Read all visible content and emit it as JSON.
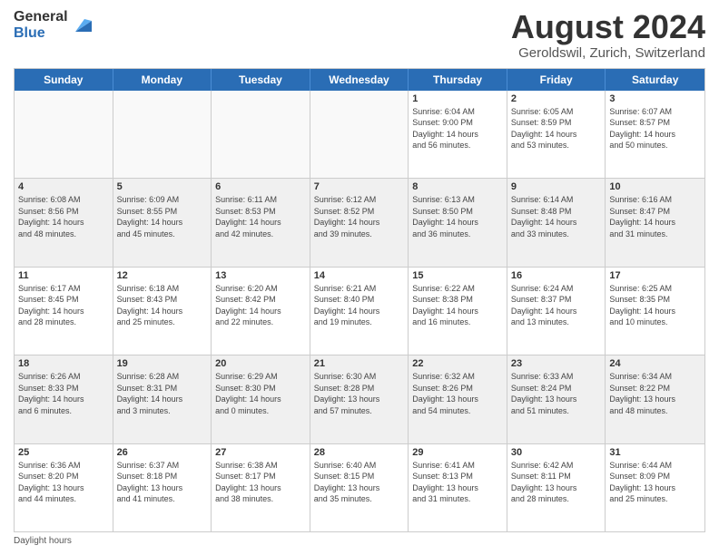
{
  "logo": {
    "general": "General",
    "blue": "Blue"
  },
  "title": "August 2024",
  "subtitle": "Geroldswil, Zurich, Switzerland",
  "header_days": [
    "Sunday",
    "Monday",
    "Tuesday",
    "Wednesday",
    "Thursday",
    "Friday",
    "Saturday"
  ],
  "footer": "Daylight hours",
  "weeks": [
    [
      {
        "day": "",
        "info": ""
      },
      {
        "day": "",
        "info": ""
      },
      {
        "day": "",
        "info": ""
      },
      {
        "day": "",
        "info": ""
      },
      {
        "day": "1",
        "info": "Sunrise: 6:04 AM\nSunset: 9:00 PM\nDaylight: 14 hours\nand 56 minutes."
      },
      {
        "day": "2",
        "info": "Sunrise: 6:05 AM\nSunset: 8:59 PM\nDaylight: 14 hours\nand 53 minutes."
      },
      {
        "day": "3",
        "info": "Sunrise: 6:07 AM\nSunset: 8:57 PM\nDaylight: 14 hours\nand 50 minutes."
      }
    ],
    [
      {
        "day": "4",
        "info": "Sunrise: 6:08 AM\nSunset: 8:56 PM\nDaylight: 14 hours\nand 48 minutes."
      },
      {
        "day": "5",
        "info": "Sunrise: 6:09 AM\nSunset: 8:55 PM\nDaylight: 14 hours\nand 45 minutes."
      },
      {
        "day": "6",
        "info": "Sunrise: 6:11 AM\nSunset: 8:53 PM\nDaylight: 14 hours\nand 42 minutes."
      },
      {
        "day": "7",
        "info": "Sunrise: 6:12 AM\nSunset: 8:52 PM\nDaylight: 14 hours\nand 39 minutes."
      },
      {
        "day": "8",
        "info": "Sunrise: 6:13 AM\nSunset: 8:50 PM\nDaylight: 14 hours\nand 36 minutes."
      },
      {
        "day": "9",
        "info": "Sunrise: 6:14 AM\nSunset: 8:48 PM\nDaylight: 14 hours\nand 33 minutes."
      },
      {
        "day": "10",
        "info": "Sunrise: 6:16 AM\nSunset: 8:47 PM\nDaylight: 14 hours\nand 31 minutes."
      }
    ],
    [
      {
        "day": "11",
        "info": "Sunrise: 6:17 AM\nSunset: 8:45 PM\nDaylight: 14 hours\nand 28 minutes."
      },
      {
        "day": "12",
        "info": "Sunrise: 6:18 AM\nSunset: 8:43 PM\nDaylight: 14 hours\nand 25 minutes."
      },
      {
        "day": "13",
        "info": "Sunrise: 6:20 AM\nSunset: 8:42 PM\nDaylight: 14 hours\nand 22 minutes."
      },
      {
        "day": "14",
        "info": "Sunrise: 6:21 AM\nSunset: 8:40 PM\nDaylight: 14 hours\nand 19 minutes."
      },
      {
        "day": "15",
        "info": "Sunrise: 6:22 AM\nSunset: 8:38 PM\nDaylight: 14 hours\nand 16 minutes."
      },
      {
        "day": "16",
        "info": "Sunrise: 6:24 AM\nSunset: 8:37 PM\nDaylight: 14 hours\nand 13 minutes."
      },
      {
        "day": "17",
        "info": "Sunrise: 6:25 AM\nSunset: 8:35 PM\nDaylight: 14 hours\nand 10 minutes."
      }
    ],
    [
      {
        "day": "18",
        "info": "Sunrise: 6:26 AM\nSunset: 8:33 PM\nDaylight: 14 hours\nand 6 minutes."
      },
      {
        "day": "19",
        "info": "Sunrise: 6:28 AM\nSunset: 8:31 PM\nDaylight: 14 hours\nand 3 minutes."
      },
      {
        "day": "20",
        "info": "Sunrise: 6:29 AM\nSunset: 8:30 PM\nDaylight: 14 hours\nand 0 minutes."
      },
      {
        "day": "21",
        "info": "Sunrise: 6:30 AM\nSunset: 8:28 PM\nDaylight: 13 hours\nand 57 minutes."
      },
      {
        "day": "22",
        "info": "Sunrise: 6:32 AM\nSunset: 8:26 PM\nDaylight: 13 hours\nand 54 minutes."
      },
      {
        "day": "23",
        "info": "Sunrise: 6:33 AM\nSunset: 8:24 PM\nDaylight: 13 hours\nand 51 minutes."
      },
      {
        "day": "24",
        "info": "Sunrise: 6:34 AM\nSunset: 8:22 PM\nDaylight: 13 hours\nand 48 minutes."
      }
    ],
    [
      {
        "day": "25",
        "info": "Sunrise: 6:36 AM\nSunset: 8:20 PM\nDaylight: 13 hours\nand 44 minutes."
      },
      {
        "day": "26",
        "info": "Sunrise: 6:37 AM\nSunset: 8:18 PM\nDaylight: 13 hours\nand 41 minutes."
      },
      {
        "day": "27",
        "info": "Sunrise: 6:38 AM\nSunset: 8:17 PM\nDaylight: 13 hours\nand 38 minutes."
      },
      {
        "day": "28",
        "info": "Sunrise: 6:40 AM\nSunset: 8:15 PM\nDaylight: 13 hours\nand 35 minutes."
      },
      {
        "day": "29",
        "info": "Sunrise: 6:41 AM\nSunset: 8:13 PM\nDaylight: 13 hours\nand 31 minutes."
      },
      {
        "day": "30",
        "info": "Sunrise: 6:42 AM\nSunset: 8:11 PM\nDaylight: 13 hours\nand 28 minutes."
      },
      {
        "day": "31",
        "info": "Sunrise: 6:44 AM\nSunset: 8:09 PM\nDaylight: 13 hours\nand 25 minutes."
      }
    ]
  ]
}
